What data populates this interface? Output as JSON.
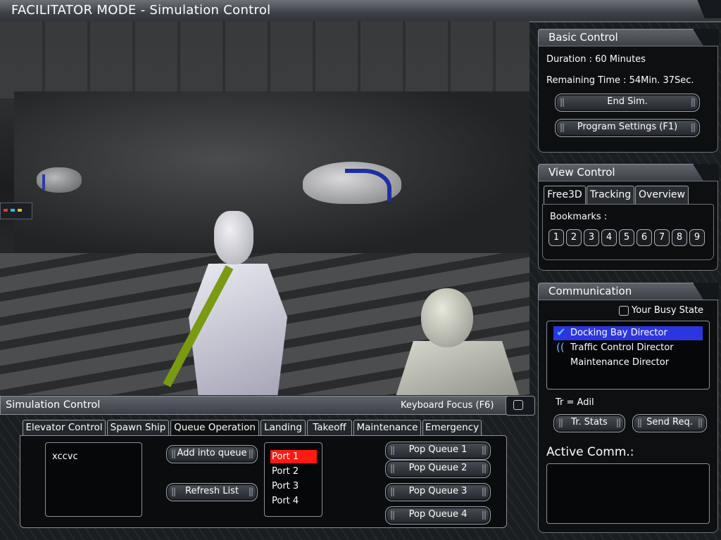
{
  "window": {
    "title": "FACILITATOR MODE - Simulation Control"
  },
  "basic_control": {
    "title": "Basic Control",
    "duration": "Duration : 60 Minutes",
    "remaining": "Remaining Time : 54Min. 37Sec.",
    "end_sim": "End Sim.",
    "program_settings": "Program Settings (F1)"
  },
  "view_control": {
    "title": "View Control",
    "tabs": [
      "Free3D",
      "Tracking",
      "Overview"
    ],
    "active_tab": "Free3D",
    "bookmarks_label": "Bookmarks :",
    "bookmarks": [
      "1",
      "2",
      "3",
      "4",
      "5",
      "6",
      "7",
      "8",
      "9"
    ]
  },
  "communication": {
    "title": "Communication",
    "busy_state_label": "Your Busy State",
    "busy_state_checked": false,
    "directors": [
      {
        "name": "Docking Bay Director",
        "selected": true,
        "icon": "checkmark-icon"
      },
      {
        "name": "Traffic Control Director",
        "selected": false,
        "icon": "signal-icon"
      },
      {
        "name": "Maintenance Director",
        "selected": false,
        "icon": ""
      }
    ],
    "tr_label": "Tr = Adil",
    "tr_stats": "Tr. Stats",
    "send_req": "Send Req.",
    "active_comm_label": "Active Comm.:"
  },
  "sim_control": {
    "title": "Simulation Control",
    "keyboard_focus": "Keyboard Focus (F6)",
    "tabs": [
      "Elevator Control",
      "Spawn Ship",
      "Queue Operation",
      "Landing",
      "Takeoff",
      "Maintenance",
      "Emergency"
    ],
    "active_tab": "Queue Operation",
    "queue_items": [
      "xccvc"
    ],
    "add_into_queue": "Add into queue",
    "refresh_list": "Refresh List",
    "ports": [
      "Port 1",
      "Port 2",
      "Port 3",
      "Port 4"
    ],
    "selected_port": "Port 1",
    "pop_queue": [
      "Pop Queue 1",
      "Pop Queue 2",
      "Pop Queue 3",
      "Pop Queue 4"
    ]
  },
  "colors": {
    "selection_blue": "#2b36e0",
    "selection_red": "#ff1a12",
    "sash_green": "#7a9a12"
  }
}
